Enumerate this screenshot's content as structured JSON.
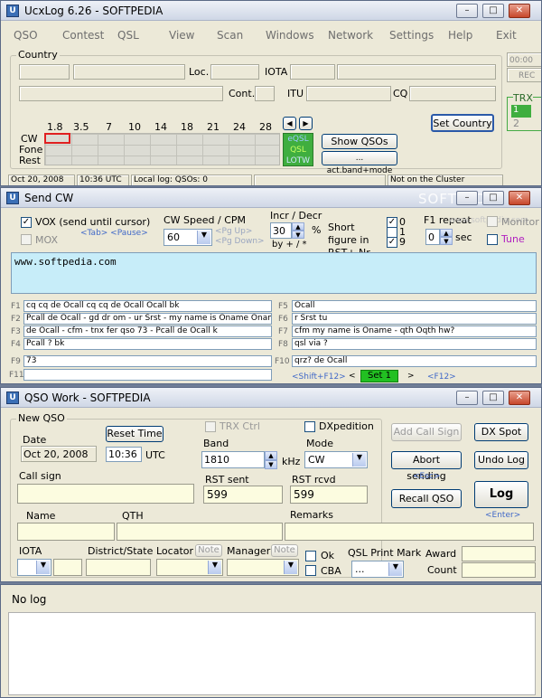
{
  "main_window": {
    "title": "UcxLog 6.26 - SOFTPEDIA",
    "menu": [
      "QSO",
      "Contest",
      "QSL",
      "View",
      "Scan",
      "Windows",
      "Network",
      "Settings",
      "Help",
      "Exit"
    ],
    "country_group": "Country",
    "loc_label": "Loc.",
    "iota_label": "IOTA",
    "cont_label": "Cont.",
    "itu_label": "ITU",
    "cq_label": "CQ",
    "bands": [
      "1.8",
      "3.5",
      "7",
      "10",
      "14",
      "18",
      "21",
      "24",
      "28"
    ],
    "modes": [
      "CW",
      "Fone",
      "Rest"
    ],
    "status_stack": [
      "eQSL",
      "QSL",
      "LOTW"
    ],
    "show_qsos": "Show QSOs",
    "act_band_mode": "... act.band+mode",
    "set_country": "Set Country",
    "clock": "00:00",
    "rec": "REC",
    "trx_label": "TRX",
    "trx1": "1",
    "trx2": "2",
    "status_bar": [
      "Oct 20, 2008",
      "10:36 UTC",
      "Local log: QSOs: 0",
      "Not on the Cluster"
    ]
  },
  "send_cw": {
    "title": "Send CW",
    "vox": "VOX (send until cursor)",
    "mox": "MOX",
    "tab_pause": "<Tab> <Pause>",
    "cw_speed_label": "CW Speed / CPM",
    "cw_speed_value": "60",
    "pg_up": "<Pg Up>",
    "pg_down": "<Pg Down>",
    "incr_label": "Incr / Decr",
    "incr_value": "30",
    "percent": "%",
    "by_keys": "by + / *",
    "short_figure": "Short figure in RST+ Nr",
    "short_opts": [
      "0",
      "1",
      "9"
    ],
    "f1_repeat_label": "F1 repeat",
    "f1_repeat_value": "0",
    "sec": "sec",
    "monitor": "Monitor",
    "tune": "Tune",
    "text_area": "www.softpedia.com",
    "watermark": "SOFTPEDIA",
    "watermark_url": "www.softpedia.com",
    "macros_left": [
      {
        "key": "F1",
        "text": "cq cq de Ocall cq cq de Ocall Ocall bk"
      },
      {
        "key": "F2",
        "text": "Pcall de Ocall - gd dr om - ur Srst - my name is Oname Oname -"
      },
      {
        "key": "F3",
        "text": "de Ocall - cfm - tnx fer qso 73 - Pcall de Ocall k"
      },
      {
        "key": "F4",
        "text": "Pcall ? bk"
      }
    ],
    "macros_right": [
      {
        "key": "F5",
        "text": "Ocall"
      },
      {
        "key": "F6",
        "text": "r Srst tu"
      },
      {
        "key": "F7",
        "text": "cfm my name is Oname - qth Oqth hw?"
      },
      {
        "key": "F8",
        "text": "qsl via ?"
      }
    ],
    "f9": {
      "key": "F9",
      "text": "73"
    },
    "f10": {
      "key": "F10",
      "text": "qrz? de Ocall"
    },
    "f11": {
      "key": "F11",
      "text": ""
    },
    "shift_f12": "<Shift+F12>",
    "set_label": "Set 1",
    "f12": "<F12>"
  },
  "qso_work": {
    "title": "QSO Work - SOFTPEDIA",
    "new_qso": "New QSO",
    "date_label": "Date",
    "date_value": "Oct 20, 2008",
    "reset_time": "Reset Time",
    "time_value": "10:36",
    "utc": "UTC",
    "trx_ctrl": "TRX Ctrl",
    "dxpedition": "DXpedition",
    "band_label": "Band",
    "band_value": "1810",
    "khz": "kHz",
    "mode_label": "Mode",
    "mode_value": "CW",
    "callsign_label": "Call sign",
    "rst_sent_label": "RST sent",
    "rst_sent_value": "599",
    "rst_rcvd_label": "RST rcvd",
    "rst_rcvd_value": "599",
    "name_label": "Name",
    "qth_label": "QTH",
    "remarks_label": "Remarks",
    "iota_label": "IOTA",
    "district_label": "District/State",
    "locator_label": "Locator",
    "note": "Note",
    "manager_label": "Manager",
    "ok": "Ok",
    "cba": "CBA",
    "qsl_print_mark": "QSL Print Mark",
    "qsl_print_value": "...",
    "award": "Award",
    "count": "Count",
    "add_call_sign": "Add Call Sign",
    "dx_spot": "DX Spot",
    "abort_sending": "Abort sending",
    "undo_log": "Undo Log",
    "esc_hint": "<Esc>",
    "recall_qso": "Recall QSO",
    "log": "Log",
    "enter_hint": "<Enter>"
  },
  "log_window": {
    "title": "No log"
  }
}
